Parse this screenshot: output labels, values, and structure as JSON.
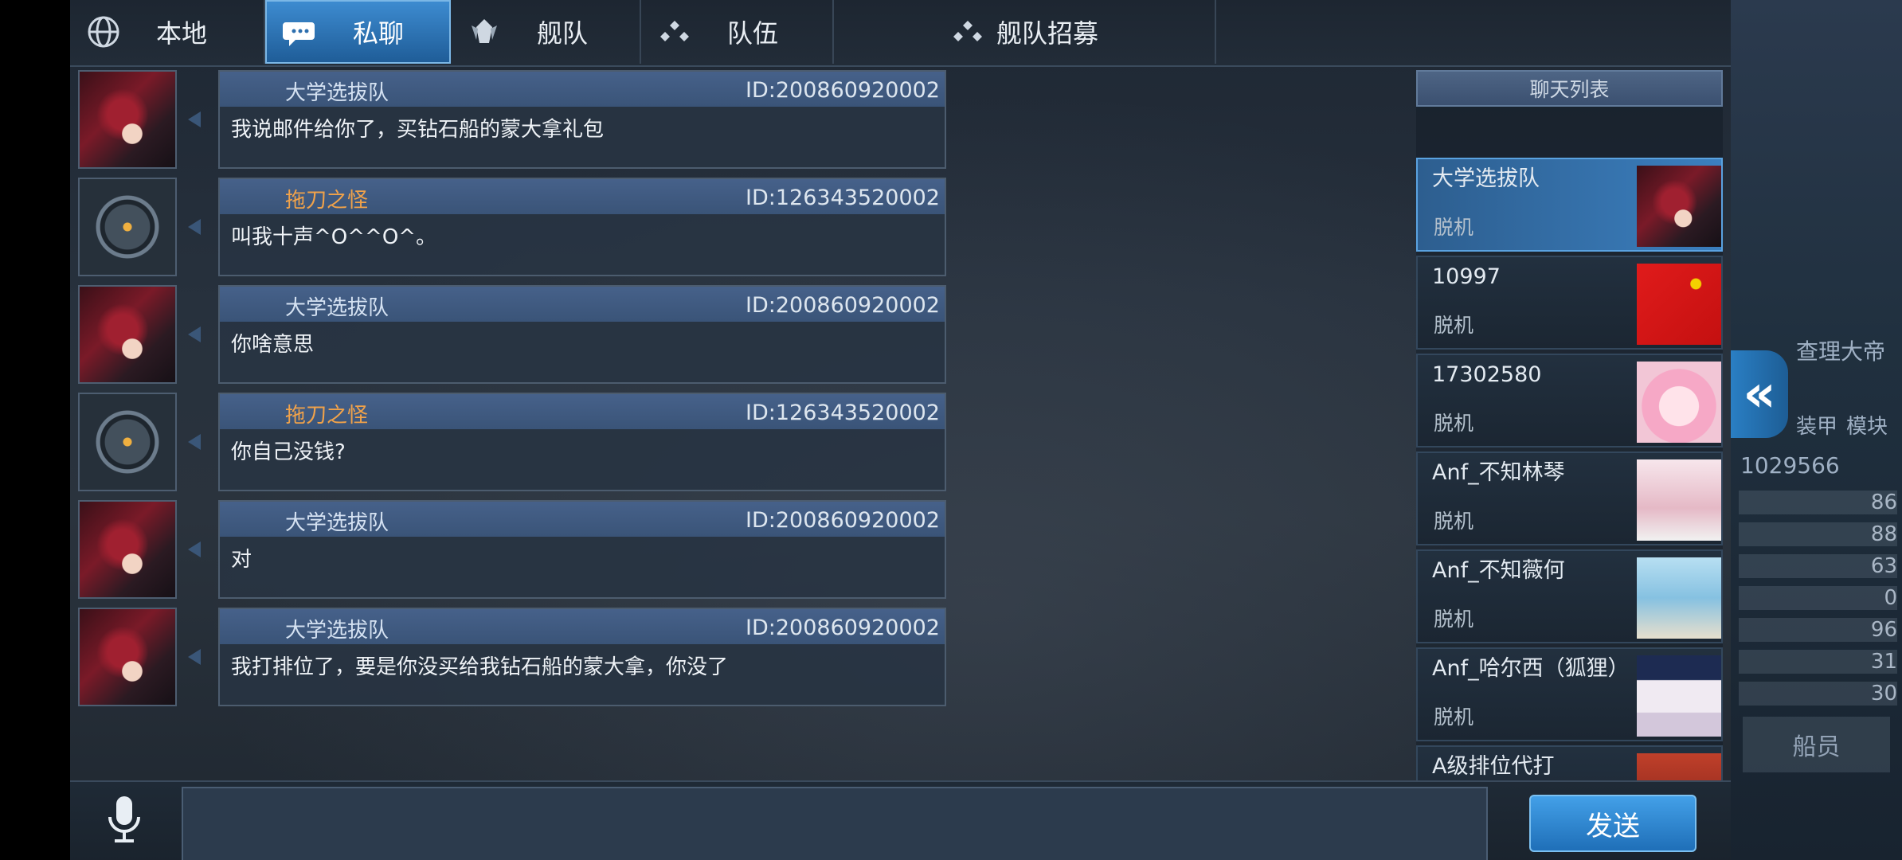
{
  "tabs": [
    {
      "label": "本地",
      "icon": "globe-icon"
    },
    {
      "label": "私聊",
      "icon": "chat-bubble-icon"
    },
    {
      "label": "舰队",
      "icon": "fleet-icon"
    },
    {
      "label": "队伍",
      "icon": "team-icon"
    },
    {
      "label": "舰队招募",
      "icon": "recruit-icon"
    }
  ],
  "messages": [
    {
      "sender": "大学选拔队",
      "sender_color": "blue",
      "id": "ID:200860920002",
      "text": "我说邮件给你了，买钻石船的蒙大拿礼包",
      "avatar": "dragon"
    },
    {
      "sender": "拖刀之怪",
      "sender_color": "orange",
      "id": "ID:126343520002",
      "text": "叫我十声^O^^O^。",
      "avatar": "emblem"
    },
    {
      "sender": "大学选拔队",
      "sender_color": "blue",
      "id": "ID:200860920002",
      "text": "你啥意思",
      "avatar": "dragon"
    },
    {
      "sender": "拖刀之怪",
      "sender_color": "orange",
      "id": "ID:126343520002",
      "text": "你自己没钱?",
      "avatar": "emblem"
    },
    {
      "sender": "大学选拔队",
      "sender_color": "blue",
      "id": "ID:200860920002",
      "text": "对",
      "avatar": "dragon"
    },
    {
      "sender": "大学选拔队",
      "sender_color": "blue",
      "id": "ID:200860920002",
      "text": "我打排位了，要是你没买给我钻石船的蒙大拿，你没了",
      "avatar": "dragon"
    }
  ],
  "chat_list": {
    "title": "聊天列表",
    "items": [
      {
        "name": "大学选拔队",
        "status": "脱机",
        "active": true
      },
      {
        "name": "10997",
        "status": "脱机"
      },
      {
        "name": "17302580",
        "status": "脱机"
      },
      {
        "name": "Anf_不知林琴",
        "status": "脱机"
      },
      {
        "name": "Anf_不知薇何",
        "status": "脱机"
      },
      {
        "name": "Anf_哈尔西（狐狸）",
        "status": "脱机"
      },
      {
        "name": "A级排位代打",
        "status": ""
      }
    ]
  },
  "input": {
    "placeholder": ""
  },
  "send_label": "发送",
  "backdrop": {
    "name": "查理大帝",
    "tab1": "装甲",
    "tab2": "模块",
    "number": "1029566",
    "stats": [
      "86",
      "88",
      "63",
      "0",
      "96",
      "31",
      "30"
    ],
    "button": "船员"
  },
  "colors": {
    "accent": "#2f7fc4",
    "orange_name": "#f0a24a"
  }
}
